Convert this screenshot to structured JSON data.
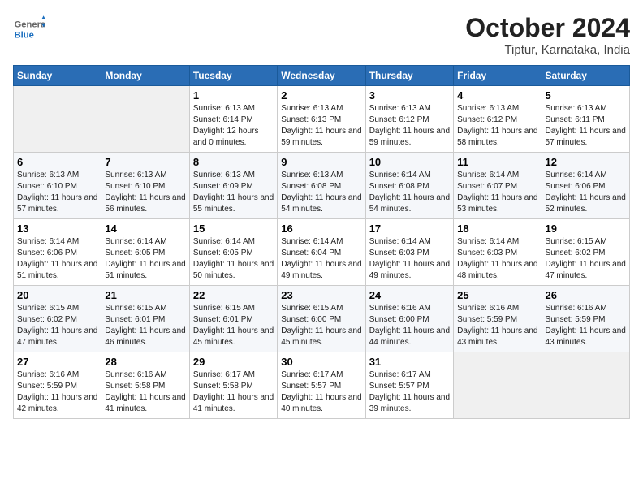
{
  "header": {
    "logo_general": "General",
    "logo_blue": "Blue",
    "title": "October 2024",
    "subtitle": "Tiptur, Karnataka, India"
  },
  "days_of_week": [
    "Sunday",
    "Monday",
    "Tuesday",
    "Wednesday",
    "Thursday",
    "Friday",
    "Saturday"
  ],
  "weeks": [
    [
      {
        "day": "",
        "info": ""
      },
      {
        "day": "",
        "info": ""
      },
      {
        "day": "1",
        "info": "Sunrise: 6:13 AM\nSunset: 6:14 PM\nDaylight: 12 hours and 0 minutes."
      },
      {
        "day": "2",
        "info": "Sunrise: 6:13 AM\nSunset: 6:13 PM\nDaylight: 11 hours and 59 minutes."
      },
      {
        "day": "3",
        "info": "Sunrise: 6:13 AM\nSunset: 6:12 PM\nDaylight: 11 hours and 59 minutes."
      },
      {
        "day": "4",
        "info": "Sunrise: 6:13 AM\nSunset: 6:12 PM\nDaylight: 11 hours and 58 minutes."
      },
      {
        "day": "5",
        "info": "Sunrise: 6:13 AM\nSunset: 6:11 PM\nDaylight: 11 hours and 57 minutes."
      }
    ],
    [
      {
        "day": "6",
        "info": "Sunrise: 6:13 AM\nSunset: 6:10 PM\nDaylight: 11 hours and 57 minutes."
      },
      {
        "day": "7",
        "info": "Sunrise: 6:13 AM\nSunset: 6:10 PM\nDaylight: 11 hours and 56 minutes."
      },
      {
        "day": "8",
        "info": "Sunrise: 6:13 AM\nSunset: 6:09 PM\nDaylight: 11 hours and 55 minutes."
      },
      {
        "day": "9",
        "info": "Sunrise: 6:13 AM\nSunset: 6:08 PM\nDaylight: 11 hours and 54 minutes."
      },
      {
        "day": "10",
        "info": "Sunrise: 6:14 AM\nSunset: 6:08 PM\nDaylight: 11 hours and 54 minutes."
      },
      {
        "day": "11",
        "info": "Sunrise: 6:14 AM\nSunset: 6:07 PM\nDaylight: 11 hours and 53 minutes."
      },
      {
        "day": "12",
        "info": "Sunrise: 6:14 AM\nSunset: 6:06 PM\nDaylight: 11 hours and 52 minutes."
      }
    ],
    [
      {
        "day": "13",
        "info": "Sunrise: 6:14 AM\nSunset: 6:06 PM\nDaylight: 11 hours and 51 minutes."
      },
      {
        "day": "14",
        "info": "Sunrise: 6:14 AM\nSunset: 6:05 PM\nDaylight: 11 hours and 51 minutes."
      },
      {
        "day": "15",
        "info": "Sunrise: 6:14 AM\nSunset: 6:05 PM\nDaylight: 11 hours and 50 minutes."
      },
      {
        "day": "16",
        "info": "Sunrise: 6:14 AM\nSunset: 6:04 PM\nDaylight: 11 hours and 49 minutes."
      },
      {
        "day": "17",
        "info": "Sunrise: 6:14 AM\nSunset: 6:03 PM\nDaylight: 11 hours and 49 minutes."
      },
      {
        "day": "18",
        "info": "Sunrise: 6:14 AM\nSunset: 6:03 PM\nDaylight: 11 hours and 48 minutes."
      },
      {
        "day": "19",
        "info": "Sunrise: 6:15 AM\nSunset: 6:02 PM\nDaylight: 11 hours and 47 minutes."
      }
    ],
    [
      {
        "day": "20",
        "info": "Sunrise: 6:15 AM\nSunset: 6:02 PM\nDaylight: 11 hours and 47 minutes."
      },
      {
        "day": "21",
        "info": "Sunrise: 6:15 AM\nSunset: 6:01 PM\nDaylight: 11 hours and 46 minutes."
      },
      {
        "day": "22",
        "info": "Sunrise: 6:15 AM\nSunset: 6:01 PM\nDaylight: 11 hours and 45 minutes."
      },
      {
        "day": "23",
        "info": "Sunrise: 6:15 AM\nSunset: 6:00 PM\nDaylight: 11 hours and 45 minutes."
      },
      {
        "day": "24",
        "info": "Sunrise: 6:16 AM\nSunset: 6:00 PM\nDaylight: 11 hours and 44 minutes."
      },
      {
        "day": "25",
        "info": "Sunrise: 6:16 AM\nSunset: 5:59 PM\nDaylight: 11 hours and 43 minutes."
      },
      {
        "day": "26",
        "info": "Sunrise: 6:16 AM\nSunset: 5:59 PM\nDaylight: 11 hours and 43 minutes."
      }
    ],
    [
      {
        "day": "27",
        "info": "Sunrise: 6:16 AM\nSunset: 5:59 PM\nDaylight: 11 hours and 42 minutes."
      },
      {
        "day": "28",
        "info": "Sunrise: 6:16 AM\nSunset: 5:58 PM\nDaylight: 11 hours and 41 minutes."
      },
      {
        "day": "29",
        "info": "Sunrise: 6:17 AM\nSunset: 5:58 PM\nDaylight: 11 hours and 41 minutes."
      },
      {
        "day": "30",
        "info": "Sunrise: 6:17 AM\nSunset: 5:57 PM\nDaylight: 11 hours and 40 minutes."
      },
      {
        "day": "31",
        "info": "Sunrise: 6:17 AM\nSunset: 5:57 PM\nDaylight: 11 hours and 39 minutes."
      },
      {
        "day": "",
        "info": ""
      },
      {
        "day": "",
        "info": ""
      }
    ]
  ]
}
